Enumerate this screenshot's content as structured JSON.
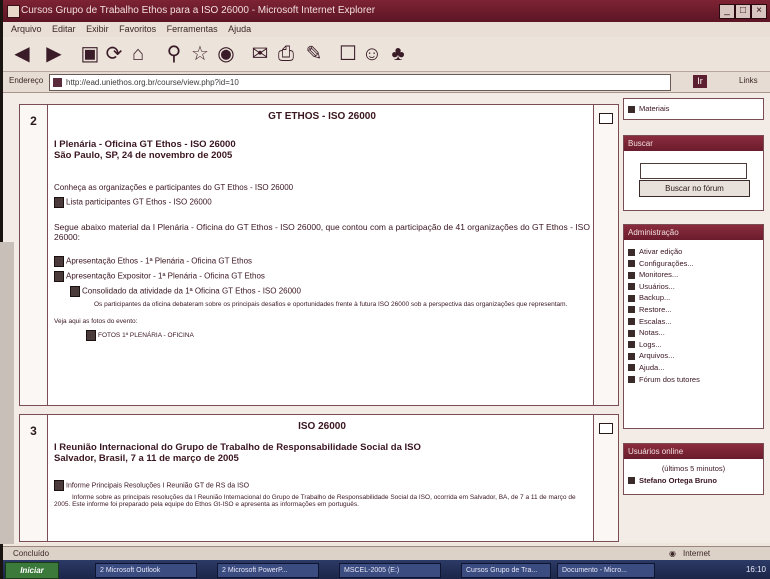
{
  "window": {
    "title": "Cursos Grupo de Trabalho Ethos para a ISO 26000 - Microsoft Internet Explorer",
    "controls": [
      "_",
      "□",
      "×"
    ]
  },
  "menu": [
    "Arquivo",
    "Editar",
    "Exibir",
    "Favoritos",
    "Ferramentas",
    "Ajuda"
  ],
  "address": {
    "label": "Endereço",
    "url": "http://ead.uniethos.org.br/course/view.php?id=10",
    "go_label": "Ir",
    "links_label": "Links"
  },
  "topics": [
    {
      "number": "2",
      "title": "GT ETHOS - ISO 26000",
      "heading1": "I Plenária - Oficina GT Ethos - ISO 26000",
      "heading2": "São Paulo, SP, 24 de novembro de 2005",
      "greeting": "Conheça as organizações e participantes do GT Ethos - ISO 26000",
      "participants_link": "Lista participantes GT Ethos - ISO 26000",
      "intro": "Segue abaixo material da I Plenária - Oficina do GT Ethos - ISO 26000, que contou com a participação de 41 organizações do GT Ethos - ISO 26000:",
      "links": [
        "Apresentação Ethos - 1ª Plenária - Oficina GT Ethos",
        "Apresentação Expositor - 1ª Plenária - Oficina GT Ethos",
        "Consolidado da atividade da 1ª Oficina GT Ethos - ISO 26000"
      ],
      "note": "Os participantes da oficina debateram sobre os principais desafios e oportunidades frente à futura ISO 26000 sob a perspectiva das organizações que representam.",
      "photos_intro": "Veja aqui as fotos do evento:",
      "photos_link": "FOTOS 1ª PLENÁRIA - OFICINA"
    },
    {
      "number": "3",
      "title": "ISO 26000",
      "heading1": "I Reunião Internacional do Grupo de Trabalho de Responsabilidade Social da ISO",
      "heading2": "Salvador, Brasil, 7 a 11 de março de 2005",
      "link": "Informe Principais Resoluções I Reunião GT de RS da ISO",
      "desc": "Informe sobre as principais resoluções da I Reunião Internacional do Grupo de Trabalho de Responsabilidade Social da ISO, ocorrida em Salvador, BA, de 7 a 11 de março de 2005. Este informe foi preparado pela equipe do Ethos Gt-ISO e apresenta as informações em português."
    }
  ],
  "sidebar": {
    "materials_label": "Materiais",
    "search": {
      "header": "Buscar",
      "button": "Buscar no fórum"
    },
    "admin": {
      "header": "Administração",
      "items": [
        "Ativar edição",
        "Configurações...",
        "Monitores...",
        "Usuários...",
        "Backup...",
        "Restore...",
        "Escalas...",
        "Notas...",
        "Logs...",
        "Arquivos...",
        "Ajuda...",
        "Fórum dos tutores"
      ]
    },
    "users": {
      "header": "Usuários online",
      "note": "(últimos 5 minutos)",
      "user": "Stefano Ortega Bruno"
    }
  },
  "status": {
    "left": "Concluído",
    "right": "Internet"
  },
  "taskbar": {
    "start": "Iniciar",
    "items": [
      "2 Microsoft Outlook",
      "2 Microsoft PowerP...",
      "MSCEL-2005 (E:)",
      "Cursos Grupo de Tra...",
      "Documento - Micro..."
    ],
    "clock": "16:10"
  }
}
